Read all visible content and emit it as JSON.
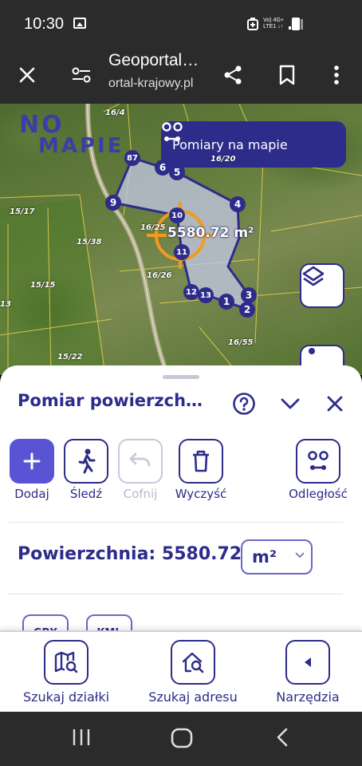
{
  "status_bar": {
    "time": "10:30",
    "network_top": "Vo) 4G+",
    "network_bottom": "LTE1 ↓↑"
  },
  "header": {
    "title": "Geoportal…",
    "url": "ortal-krajowy.pl"
  },
  "map": {
    "logo_line1": "NO",
    "logo_line2": "MAPIE",
    "measure_chip_label": "Pomiary na mapie",
    "area_label": "5580.72 m²",
    "vertices": [
      "87",
      "6",
      "5",
      "4",
      "3",
      "2",
      "1",
      "13",
      "12",
      "11",
      "10",
      "9"
    ],
    "parcels": [
      "16/4",
      "16/20",
      "15/17",
      "15/38",
      "15/15",
      "16/26",
      "16/55",
      "15/22",
      "16/25",
      "13"
    ]
  },
  "panel": {
    "title": "Pomiar powierzch…",
    "tools": {
      "add": "Dodaj",
      "track": "Śledź",
      "undo": "Cofnij",
      "clear": "Wyczyść",
      "distance": "Odległość"
    },
    "area_label": "Powierzchnia:",
    "area_value": "5580.72",
    "unit": "m²",
    "export_buttons": [
      "GPX",
      "KML"
    ]
  },
  "bottom_nav": {
    "search_parcel": "Szukaj działki",
    "search_address": "Szukaj adresu",
    "tools": "Narzędzia"
  },
  "colors": {
    "primary": "#2d2c8a",
    "accent": "#5a54d4",
    "crosshair": "#f39a1f",
    "polygon_fill": "#b9bfd9"
  }
}
